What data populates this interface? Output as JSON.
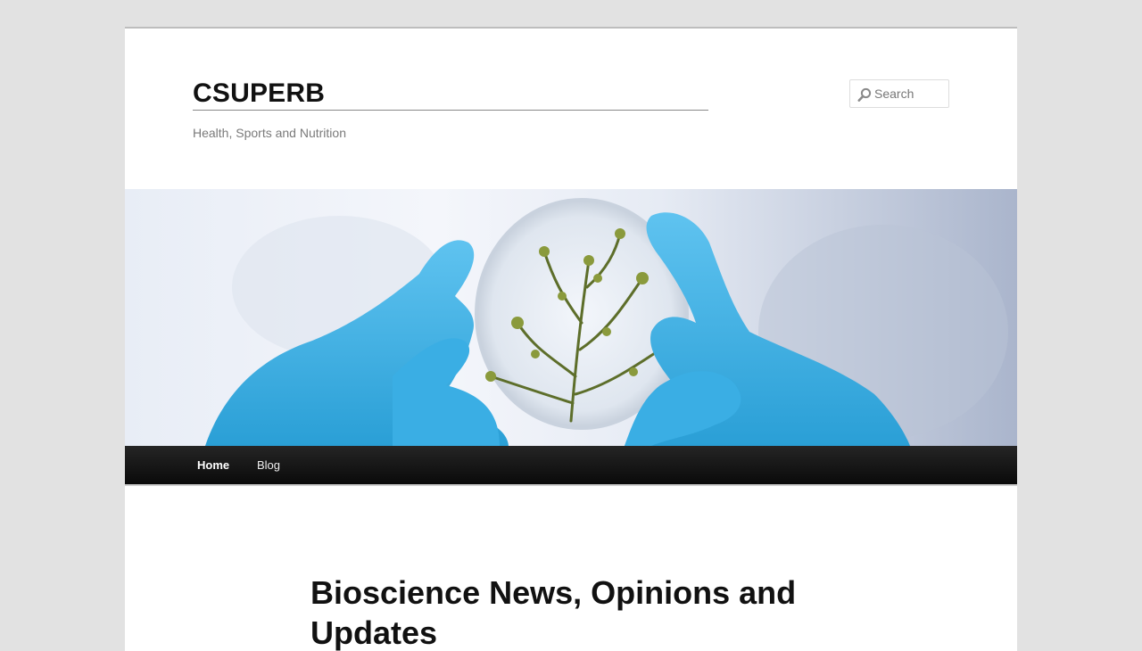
{
  "site": {
    "title": "CSUPERB",
    "description": "Health, Sports and Nutrition"
  },
  "search": {
    "placeholder": "Search",
    "icon": "search-icon"
  },
  "header_image": {
    "description_icon": "lab-petri-dish-image"
  },
  "nav": {
    "items": [
      {
        "label": "Home",
        "active": true
      },
      {
        "label": "Blog",
        "active": false
      }
    ]
  },
  "content": {
    "title": "Bioscience News, Opinions and Updates"
  },
  "colors": {
    "background": "#e2e2e2",
    "page": "#ffffff",
    "nav": "#111111",
    "glove": "#3fb0e6"
  }
}
